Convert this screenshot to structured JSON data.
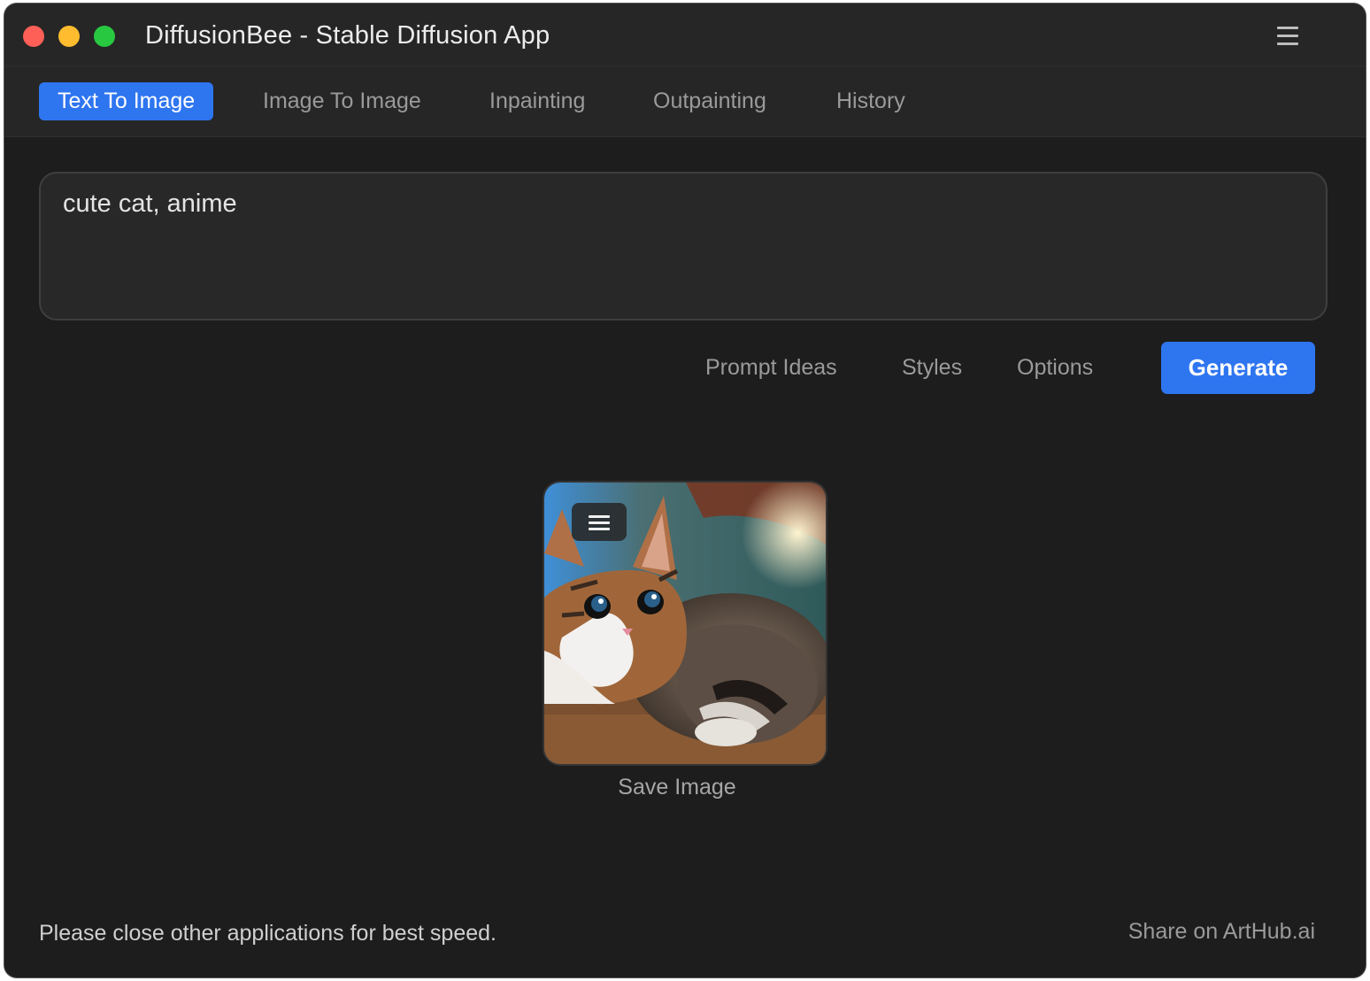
{
  "window": {
    "title": "DiffusionBee - Stable Diffusion App"
  },
  "tabs": [
    {
      "label": "Text To Image",
      "active": true
    },
    {
      "label": "Image To Image",
      "active": false
    },
    {
      "label": "Inpainting",
      "active": false
    },
    {
      "label": "Outpainting",
      "active": false
    },
    {
      "label": "History",
      "active": false
    }
  ],
  "prompt": {
    "value": "cute cat, anime"
  },
  "actions": {
    "prompt_ideas": "Prompt Ideas",
    "styles": "Styles",
    "options": "Options",
    "generate": "Generate"
  },
  "result": {
    "image_icon": "generated-cat-image",
    "menu_icon": "hamburger-menu-icon",
    "save_label": "Save Image"
  },
  "footer": {
    "status": "Please close other applications for best speed.",
    "share": "Share on ArtHub.ai"
  },
  "colors": {
    "accent": "#2e75f0",
    "background": "#1d1d1d",
    "panel": "#262626"
  }
}
